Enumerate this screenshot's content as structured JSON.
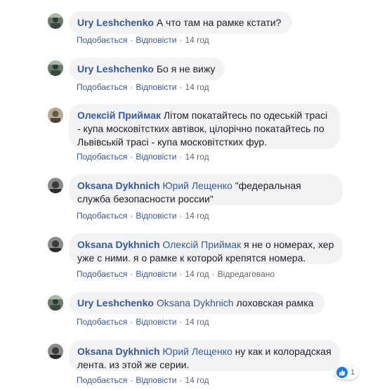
{
  "labels": {
    "like": "Подобається",
    "reply": "Відповісти",
    "edited": "Відредаговано",
    "sep": "·"
  },
  "comments": [
    {
      "author": "Ury Leshchenko",
      "mention": "",
      "text": "А что там на рамке кстати?",
      "time": "14 год"
    },
    {
      "author": "Ury Leshchenko",
      "mention": "",
      "text": "Бо я не вижу",
      "time": "14 год"
    },
    {
      "author": "Олексій Приймак",
      "mention": "",
      "text": "Літом покатайтесь по одеській трасі - купа московітстких автівок, цілорічно покатайтесь по Львівській трасі - купа московітстких фур.",
      "time": "14 год"
    },
    {
      "author": "Oksana Dykhnich",
      "mention": "Юрий Лещенко",
      "text": "\"федеральная служба безопасности россии\"",
      "time": "14 год"
    },
    {
      "author": "Oksana Dykhnich",
      "mention": "Олексій Приймак",
      "text": "я не о номерах, хер уже с ними. я о рамке к которой крепятся номера.",
      "time": "14 год"
    },
    {
      "author": "Ury Leshchenko",
      "mention": "Oksana Dykhnich",
      "text": "лоховская рамка",
      "time": "14 год"
    },
    {
      "author": "Oksana Dykhnich",
      "mention": "Юрий Лещенко",
      "text": "ну как и колорадская лента. из этой же серии.",
      "time": "14 год"
    }
  ],
  "reactions": {
    "count": "1",
    "icon": "like-icon",
    "color": "#1877f2"
  }
}
